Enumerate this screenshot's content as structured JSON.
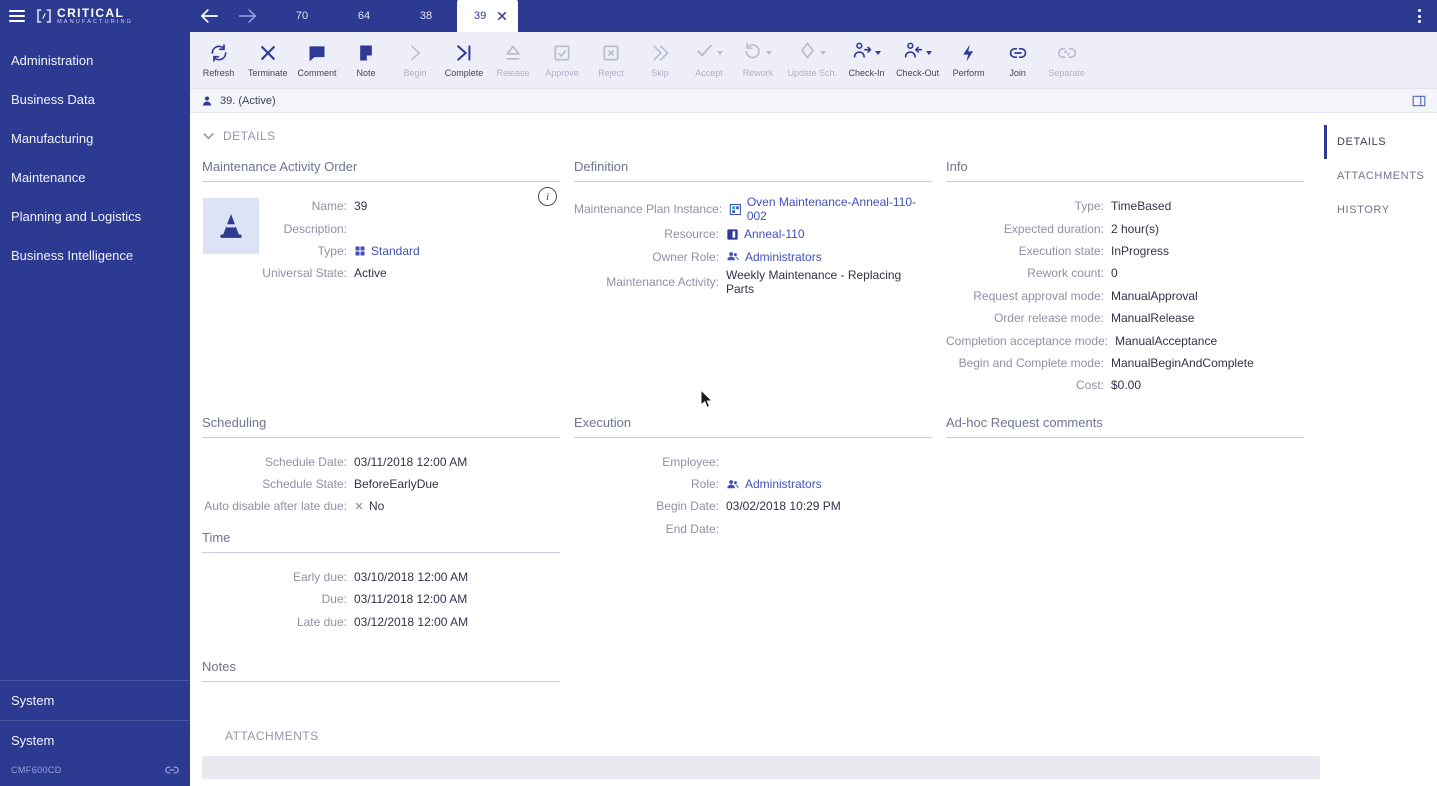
{
  "colors": {
    "primary": "#2d3a91",
    "link": "#3f51b5",
    "toolbar_bg": "#edeef7",
    "disabled_icon": "#b7bbd2"
  },
  "logo": {
    "line1": "CRITICAL",
    "line2": "MANUFACTURING"
  },
  "sidebar": {
    "items": [
      "Administration",
      "Business Data",
      "Manufacturing",
      "Maintenance",
      "Planning and Logistics",
      "Business Intelligence"
    ],
    "bottom_items": [
      "System",
      "System"
    ],
    "version": "CMF600CD"
  },
  "tabbar": {
    "tabs": [
      "70",
      "64",
      "38",
      "39"
    ],
    "active_tab": "39"
  },
  "toolbar": {
    "buttons": [
      {
        "label": "Refresh",
        "enabled": true
      },
      {
        "label": "Terminate",
        "enabled": true
      },
      {
        "label": "Comment",
        "enabled": true
      },
      {
        "label": "Note",
        "enabled": true
      },
      {
        "label": "Begin",
        "enabled": false
      },
      {
        "label": "Complete",
        "enabled": true
      },
      {
        "label": "Release",
        "enabled": false
      },
      {
        "label": "Approve",
        "enabled": false
      },
      {
        "label": "Reject",
        "enabled": false
      },
      {
        "label": "Skip",
        "enabled": false
      },
      {
        "label": "Accept",
        "enabled": false,
        "has_dropdown": true
      },
      {
        "label": "Rework",
        "enabled": false,
        "has_dropdown": true
      },
      {
        "label": "Update Sch.",
        "enabled": false,
        "has_dropdown": true
      },
      {
        "label": "Check-In",
        "enabled": true,
        "has_dropdown": true
      },
      {
        "label": "Check-Out",
        "enabled": true,
        "has_dropdown": true
      },
      {
        "label": "Perform",
        "enabled": true
      },
      {
        "label": "Join",
        "enabled": true
      },
      {
        "label": "Separate",
        "enabled": false
      }
    ]
  },
  "breadcrumb": {
    "title": "39. (Active)"
  },
  "right_nav": {
    "items": [
      "DETAILS",
      "ATTACHMENTS",
      "HISTORY"
    ],
    "active": "DETAILS"
  },
  "icons": {
    "info_badge": "i"
  },
  "details": {
    "header": "DETAILS",
    "mao": {
      "title": "Maintenance Activity Order",
      "rows": [
        {
          "label": "Name:",
          "value": "39"
        },
        {
          "label": "Description:",
          "value": ""
        },
        {
          "label": "Type:",
          "value": "Standard"
        },
        {
          "label": "Universal State:",
          "value": "Active"
        }
      ]
    },
    "definition": {
      "title": "Definition",
      "rows": [
        {
          "label": "Maintenance Plan Instance:",
          "value": "Oven Maintenance-Anneal-110-002"
        },
        {
          "label": "Resource:",
          "value": "Anneal-110"
        },
        {
          "label": "Owner Role:",
          "value": "Administrators"
        },
        {
          "label": "Maintenance Activity:",
          "value": "Weekly Maintenance - Replacing Parts"
        }
      ]
    },
    "info": {
      "title": "Info",
      "rows": [
        {
          "label": "Type:",
          "value": "TimeBased"
        },
        {
          "label": "Expected duration:",
          "value": "2 hour(s)"
        },
        {
          "label": "Execution state:",
          "value": "InProgress"
        },
        {
          "label": "Rework count:",
          "value": "0"
        },
        {
          "label": "Request approval mode:",
          "value": "ManualApproval"
        },
        {
          "label": "Order release mode:",
          "value": "ManualRelease"
        },
        {
          "label": "Completion acceptance mode:",
          "value": "ManualAcceptance"
        },
        {
          "label": "Begin and Complete mode:",
          "value": "ManualBeginAndComplete"
        },
        {
          "label": "Cost:",
          "value": "$0.00"
        }
      ]
    },
    "scheduling": {
      "title": "Scheduling",
      "rows": [
        {
          "label": "Schedule Date:",
          "value": "03/11/2018 12:00 AM"
        },
        {
          "label": "Schedule State:",
          "value": "BeforeEarlyDue"
        },
        {
          "label": "Auto disable after late due:",
          "value": "No"
        }
      ]
    },
    "time": {
      "title": "Time",
      "rows": [
        {
          "label": "Early due:",
          "value": "03/10/2018 12:00 AM"
        },
        {
          "label": "Due:",
          "value": "03/11/2018 12:00 AM"
        },
        {
          "label": "Late due:",
          "value": "03/12/2018 12:00 AM"
        }
      ]
    },
    "execution": {
      "title": "Execution",
      "rows": [
        {
          "label": "Employee:",
          "value": ""
        },
        {
          "label": "Role:",
          "value": "Administrators"
        },
        {
          "label": "Begin Date:",
          "value": "03/02/2018 10:29 PM"
        },
        {
          "label": "End Date:",
          "value": ""
        }
      ]
    },
    "adhoc": {
      "title": "Ad-hoc Request comments"
    },
    "notes": {
      "title": "Notes"
    }
  },
  "attachments": {
    "header": "ATTACHMENTS"
  }
}
